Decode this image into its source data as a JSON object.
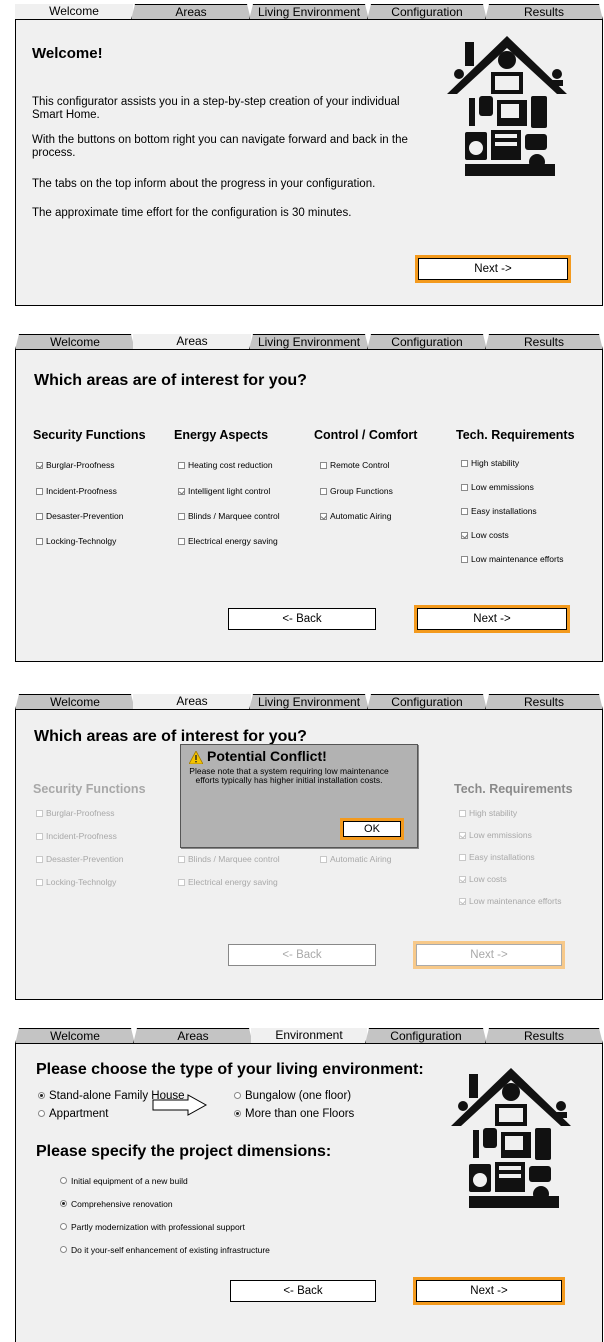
{
  "tabs": {
    "welcome": "Welcome",
    "areas": "Areas",
    "living": "Living Environment",
    "environment": "Environment",
    "configuration": "Configuration",
    "results": "Results"
  },
  "nav": {
    "next": "Next ->",
    "back": "<- Back"
  },
  "screen1": {
    "heading": "Welcome!",
    "paragraphs": [
      "This configurator assists you in a step-by-step creation of your individual Smart Home.",
      "With the buttons on bottom right you can navigate forward and back in the process.",
      "The tabs on the top inform about the progress in your configuration.",
      "The approximate time effort for the configuration is 30 minutes."
    ]
  },
  "areas": {
    "heading": "Which areas are of interest for you?",
    "columns": [
      {
        "title": "Security Functions",
        "items": [
          {
            "label": "Burglar-Proofness",
            "checked": true
          },
          {
            "label": "Incident-Proofness",
            "checked": false
          },
          {
            "label": "Desaster-Prevention",
            "checked": false
          },
          {
            "label": "Locking-Technolgy",
            "checked": false
          }
        ]
      },
      {
        "title": "Energy Aspects",
        "items": [
          {
            "label": "Heating cost reduction",
            "checked": false
          },
          {
            "label": "Intelligent light control",
            "checked": true
          },
          {
            "label": "Blinds / Marquee control",
            "checked": false
          },
          {
            "label": "Electrical energy saving",
            "checked": false
          }
        ]
      },
      {
        "title": "Control / Comfort",
        "items": [
          {
            "label": "Remote Control",
            "checked": false
          },
          {
            "label": "Group Functions",
            "checked": false
          },
          {
            "label": "Automatic Airing",
            "checked": true
          }
        ]
      },
      {
        "title": "Tech. Requirements",
        "items": [
          {
            "label": "High stability",
            "checked": false
          },
          {
            "label": "Low emmissions",
            "checked": false
          },
          {
            "label": "Easy installations",
            "checked": false
          },
          {
            "label": "Low costs",
            "checked": true
          },
          {
            "label": "Low maintenance efforts",
            "checked": false
          }
        ]
      }
    ]
  },
  "screen3": {
    "tech_checked": [
      false,
      true,
      false,
      true,
      true
    ],
    "dialog": {
      "title": "Potential Conflict!",
      "message": "Please note that a system requiring low maintenance efforts typically has higher initial installation costs.",
      "ok": "OK"
    }
  },
  "screen4": {
    "heading1": "Please choose the type of your living environment:",
    "options": [
      {
        "label": "Stand-alone Family House",
        "selected": true
      },
      {
        "label": "Bungalow (one floor)",
        "selected": false
      },
      {
        "label": "Appartment",
        "selected": false
      },
      {
        "label": "More than one Floors",
        "selected": true
      }
    ],
    "heading2": "Please specify the project dimensions:",
    "dimensions": [
      {
        "label": "Initial equipment of a new build",
        "selected": false
      },
      {
        "label": "Comprehensive renovation",
        "selected": true
      },
      {
        "label": "Partly modernization with professional support",
        "selected": false
      },
      {
        "label": "Do it your-self enhancement of existing infrastructure",
        "selected": false
      }
    ]
  },
  "colors": {
    "accent": "#f39a1e",
    "panel": "#f0f0f0",
    "tab": "#c4c4c4",
    "dialog": "#b2b2b2"
  }
}
